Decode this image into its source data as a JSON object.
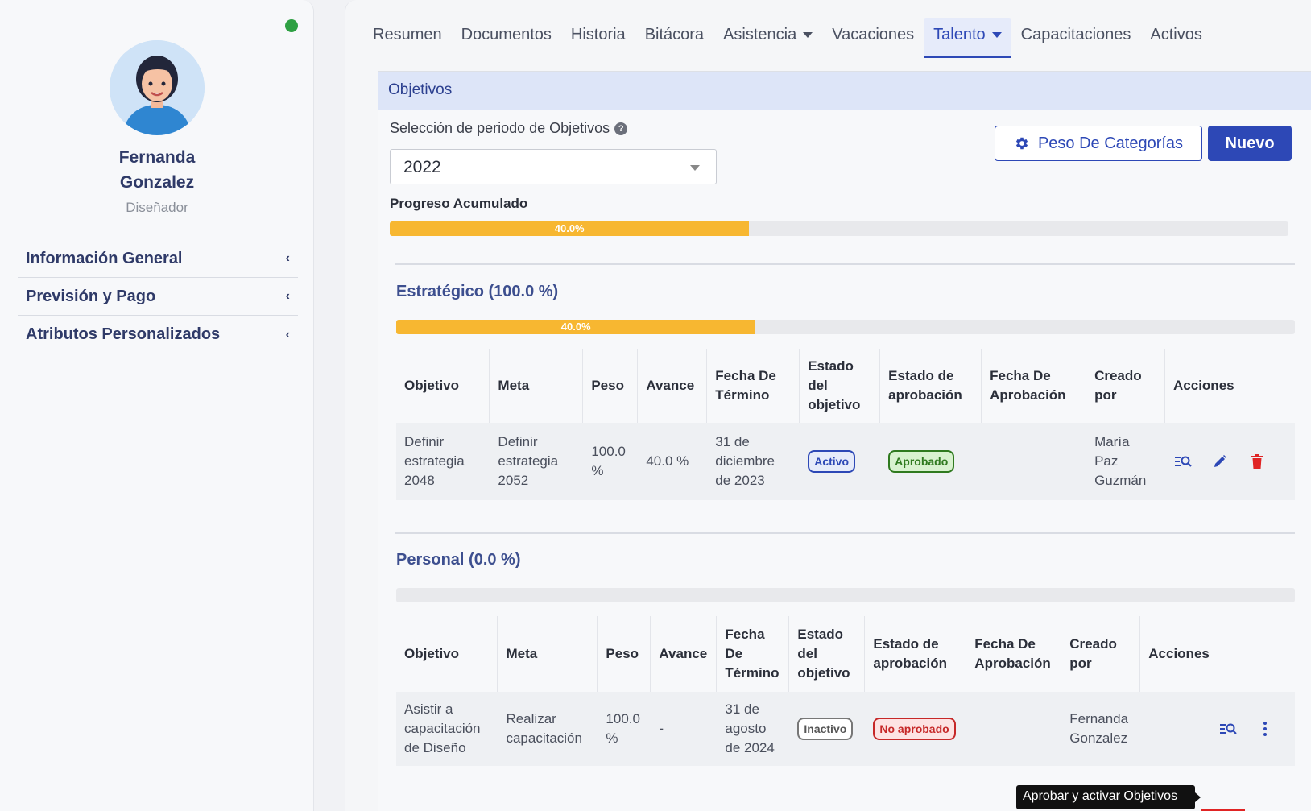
{
  "profile": {
    "name_line1": "Fernanda",
    "name_line2": "Gonzalez",
    "role": "Diseñador",
    "status_color": "#2ea043"
  },
  "sidebar": {
    "items": [
      {
        "label": "Información General"
      },
      {
        "label": "Previsión y Pago"
      },
      {
        "label": "Atributos Personalizados"
      }
    ]
  },
  "tabs": [
    "Resumen",
    "Documentos",
    "Historia",
    "Bitácora",
    "Asistencia",
    "Vacaciones",
    "Talento",
    "Capacitaciones",
    "Activos"
  ],
  "active_tab": "Talento",
  "card": {
    "title": "Objetivos",
    "period_label": "Selección de periodo de Objetivos",
    "period_value": "2022",
    "weights_button": "Peso De Categorías",
    "new_button": "Nuevo",
    "progress_label": "Progreso Acumulado",
    "progress_text": "40.0%",
    "progress_value": 0.4
  },
  "columns": [
    "Objetivo",
    "Meta",
    "Peso",
    "Avance",
    "Fecha De Término",
    "Estado del objetivo",
    "Estado de aprobación",
    "Fecha De Aprobación",
    "Creado por",
    "Acciones"
  ],
  "strategic": {
    "title": "Estratégico (100.0 %)",
    "progress_text": "40.0%",
    "progress_value": 0.4,
    "row": {
      "objetivo": "Definir estrategia 2048",
      "meta": "Definir estrategia 2052",
      "peso": "100.0 %",
      "avance": "40.0 %",
      "fecha_termino": "31 de diciembre de 2023",
      "estado": "Activo",
      "aprobacion": "Aprobado",
      "fecha_aprobacion": "",
      "creado_por": "María Paz Guzmán"
    }
  },
  "personal": {
    "title": "Personal (0.0 %)",
    "progress_value": 0,
    "row": {
      "objetivo": "Asistir a capacitación de Diseño",
      "meta": "Realizar capacitación",
      "peso": "100.0 %",
      "avance": "-",
      "fecha_termino": "31 de agosto de 2024",
      "estado": "Inactivo",
      "aprobacion": "No aprobado",
      "fecha_aprobacion": "",
      "creado_por": "Fernanda Gonzalez"
    }
  },
  "tooltip": "Aprobar y activar Objetivos",
  "colors": {
    "primary": "#2d48b6",
    "progress": "#f7b731",
    "danger": "#e02424",
    "success": "#2f7a1f"
  }
}
